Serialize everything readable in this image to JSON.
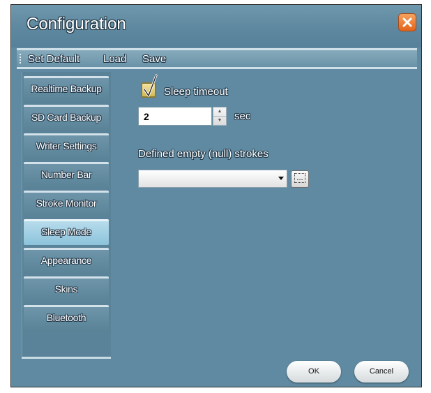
{
  "window": {
    "title": "Configuration",
    "close_icon": "close-icon"
  },
  "menu": {
    "items": [
      "Set Default",
      "Load",
      "Save"
    ]
  },
  "sidebar": {
    "items": [
      {
        "label": "Realtime Backup",
        "active": false
      },
      {
        "label": "SD Card Backup",
        "active": false
      },
      {
        "label": "Writer Settings",
        "active": false
      },
      {
        "label": "Number Bar",
        "active": false
      },
      {
        "label": "Stroke Monitor",
        "active": false
      },
      {
        "label": "Sleep Mode",
        "active": true
      },
      {
        "label": "Appearance",
        "active": false
      },
      {
        "label": "Skins",
        "active": false
      },
      {
        "label": "Bluetooth",
        "active": false
      }
    ]
  },
  "sleep": {
    "timeout_label": "Sleep timeout",
    "timeout_checked": true,
    "timeout_value": "2",
    "unit": "sec",
    "empty_strokes_label": "Defined empty (null) strokes",
    "empty_strokes_value": "",
    "browse_label": "..."
  },
  "footer": {
    "ok_label": "OK",
    "cancel_label": "Cancel"
  },
  "colors": {
    "window_bg": "#5f8aa1",
    "active_nav": "#a9d4e7",
    "close_button": "#ee7a2c",
    "checkbox": "#e3cc73"
  }
}
